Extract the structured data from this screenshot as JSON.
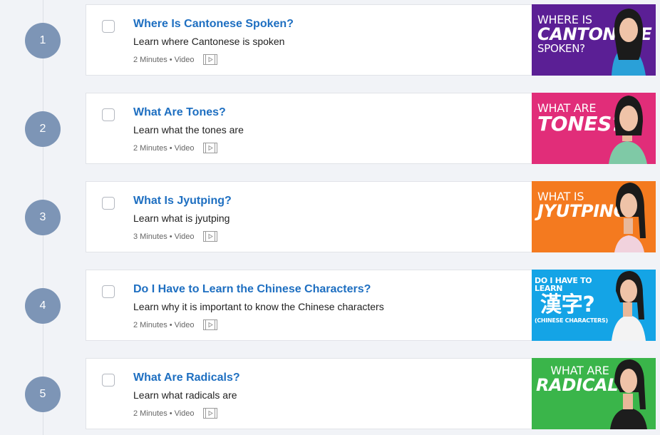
{
  "lessons": [
    {
      "number": "1",
      "title": "Where Is Cantonese Spoken?",
      "description": "Learn where Cantonese is spoken",
      "duration": "2 Minutes",
      "type": "Video",
      "thumbnail": {
        "bg": "#5b1f95",
        "line1": "WHERE IS",
        "line2": "CANTONESE",
        "line3": "SPOKEN?"
      }
    },
    {
      "number": "2",
      "title": "What Are Tones?",
      "description": "Learn what the tones are",
      "duration": "2 Minutes",
      "type": "Video",
      "thumbnail": {
        "bg": "#e12d79",
        "line1": "WHAT ARE",
        "line2": "TONES?",
        "line3": ""
      }
    },
    {
      "number": "3",
      "title": "What Is Jyutping?",
      "description": "Learn what is jyutping",
      "duration": "3 Minutes",
      "type": "Video",
      "thumbnail": {
        "bg": "#f47a1f",
        "line1": "WHAT IS",
        "line2": "JYUTPING?",
        "line3": ""
      }
    },
    {
      "number": "4",
      "title": "Do I Have to Learn the Chinese Characters?",
      "description": "Learn why it is important to know the Chinese characters",
      "duration": "2 Minutes",
      "type": "Video",
      "thumbnail": {
        "bg": "#14a4e6",
        "line1": "DO I HAVE TO LEARN",
        "line2": "漢字?",
        "line3": "(CHINESE CHARACTERS)"
      }
    },
    {
      "number": "5",
      "title": "What Are Radicals?",
      "description": "Learn what radicals are",
      "duration": "2 Minutes",
      "type": "Video",
      "thumbnail": {
        "bg": "#3ab54a",
        "line1": "WHAT ARE",
        "line2": "RADICALS",
        "line3": ""
      }
    }
  ],
  "meta_separator": "•",
  "icons": {
    "checkbox": "checkbox-icon",
    "video": "film-strip-icon"
  }
}
